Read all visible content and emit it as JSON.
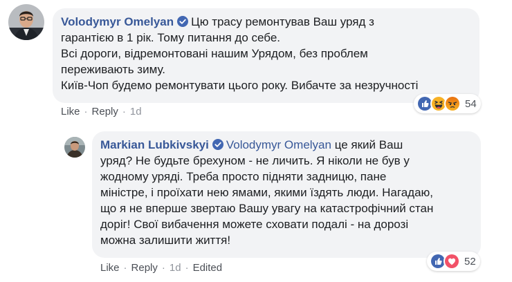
{
  "comments": [
    {
      "author": "Volodymyr Omelyan",
      "text_lines": [
        "Цю трасу ремонтував Ваш уряд з",
        "гарантією в 1 рік. Тому питання до себе.",
        "Всі дороги, відремонтовані нашим Урядом, без проблем",
        "переживають зиму.",
        "Київ-Чоп будемо ремонтувати цього року. Вибачте за незручності"
      ],
      "actions": {
        "like": "Like",
        "reply": "Reply",
        "time": "1d"
      },
      "reactions": {
        "icons": [
          "like-icon",
          "haha-icon",
          "angry-icon"
        ],
        "count": "54"
      }
    },
    {
      "author": "Markian Lubkivskyi",
      "mention": "Volodymyr Omelyan",
      "text_lines": [
        " це який Ваш",
        "уряд? Не будьте брехуном - не личить. Я ніколи не був у",
        "жодному уряді. Треба просто підняти задницю, пане",
        "міністре, і проїхати нею ямами, якими їздять люди. Нагадаю,",
        "що я не вперше звертаю Вашу увагу на катастрофічний стан",
        "доріг! Свої вибачення можете сховати подалі - на дорозі",
        "можна залишити життя!"
      ],
      "actions": {
        "like": "Like",
        "reply": "Reply",
        "time": "1d",
        "edited": "Edited"
      },
      "reactions": {
        "icons": [
          "like-icon",
          "love-icon"
        ],
        "count": "52"
      }
    }
  ],
  "colors": {
    "author_link": "#385898",
    "bubble_bg": "#f2f3f5",
    "verified": "#4267b2",
    "action_text": "#4b4f56"
  }
}
